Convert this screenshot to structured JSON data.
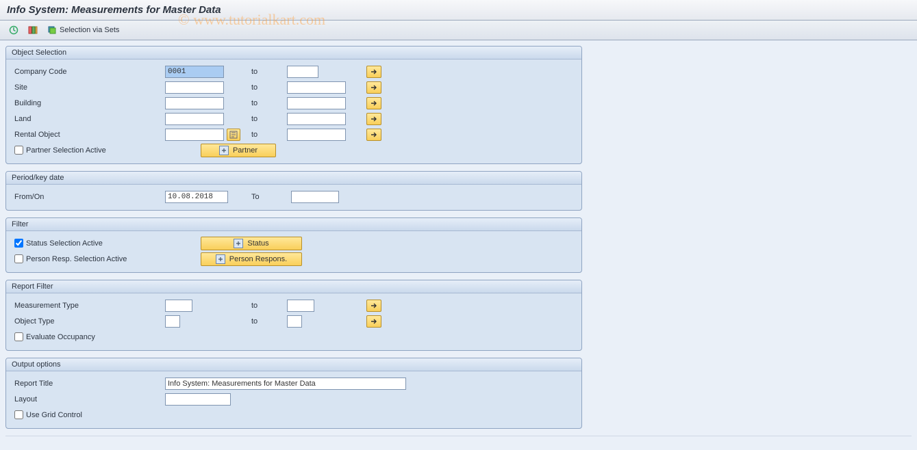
{
  "title": "Info System: Measurements for Master Data",
  "toolbar": {
    "selection_via_sets": "Selection via Sets"
  },
  "watermark": "© www.tutorialkart.com",
  "groups": {
    "object_selection": {
      "header": "Object Selection",
      "company_code": "Company Code",
      "company_code_value": "0001",
      "site": "Site",
      "building": "Building",
      "land": "Land",
      "rental_object": "Rental Object",
      "to": "to",
      "partner_selection_active": "Partner Selection Active",
      "partner_button": "Partner"
    },
    "period": {
      "header": "Period/key date",
      "from_on": "From/On",
      "from_on_value": "10.08.2018",
      "to": "To"
    },
    "filter": {
      "header": "Filter",
      "status_selection_active": "Status Selection Active",
      "status_button": "Status",
      "person_resp_selection_active": "Person Resp. Selection Active",
      "person_respons_button": "Person Respons."
    },
    "report_filter": {
      "header": "Report Filter",
      "measurement_type": "Measurement Type",
      "object_type": "Object Type",
      "to": "to",
      "evaluate_occupancy": "Evaluate Occupancy"
    },
    "output_options": {
      "header": "Output options",
      "report_title": "Report Title",
      "report_title_value": "Info System: Measurements for Master Data",
      "layout": "Layout",
      "use_grid_control": "Use Grid Control"
    }
  }
}
